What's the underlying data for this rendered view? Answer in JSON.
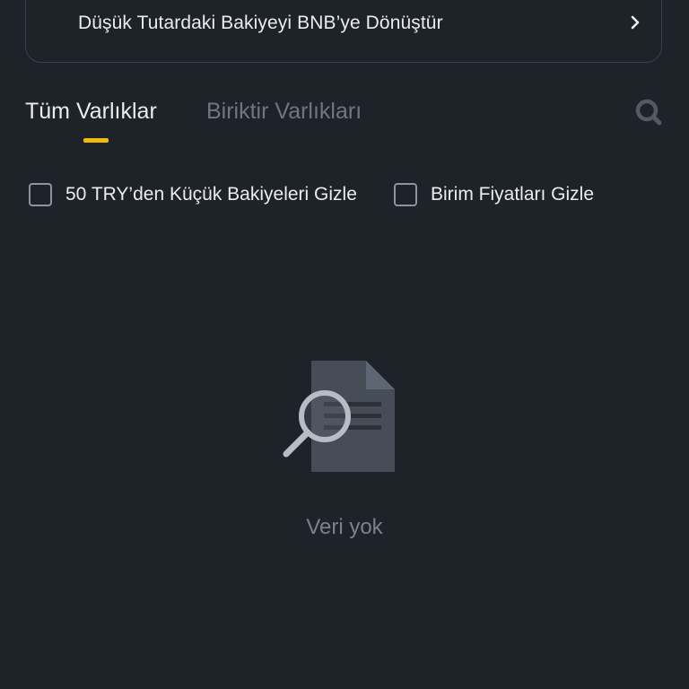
{
  "convert_banner": {
    "label": "Düşük Tutardaki Bakiyeyi BNB’ye Dönüştür",
    "icon": "chevron-right-icon"
  },
  "tabs": [
    {
      "label": "Tüm Varlıklar",
      "active": true
    },
    {
      "label": "Biriktir Varlıkları",
      "active": false
    }
  ],
  "search": {
    "icon": "search-icon"
  },
  "filters": [
    {
      "label": "50 TRY’den Küçük Bakiyeleri Gizle",
      "checked": false
    },
    {
      "label": "Birim Fiyatları Gizle",
      "checked": false
    }
  ],
  "empty_state": {
    "icon": "document-search-icon",
    "text": "Veri yok"
  },
  "colors": {
    "background": "#1e2329",
    "accent": "#f0b90b",
    "text_primary": "#eaecef",
    "text_secondary": "#6e7683"
  }
}
